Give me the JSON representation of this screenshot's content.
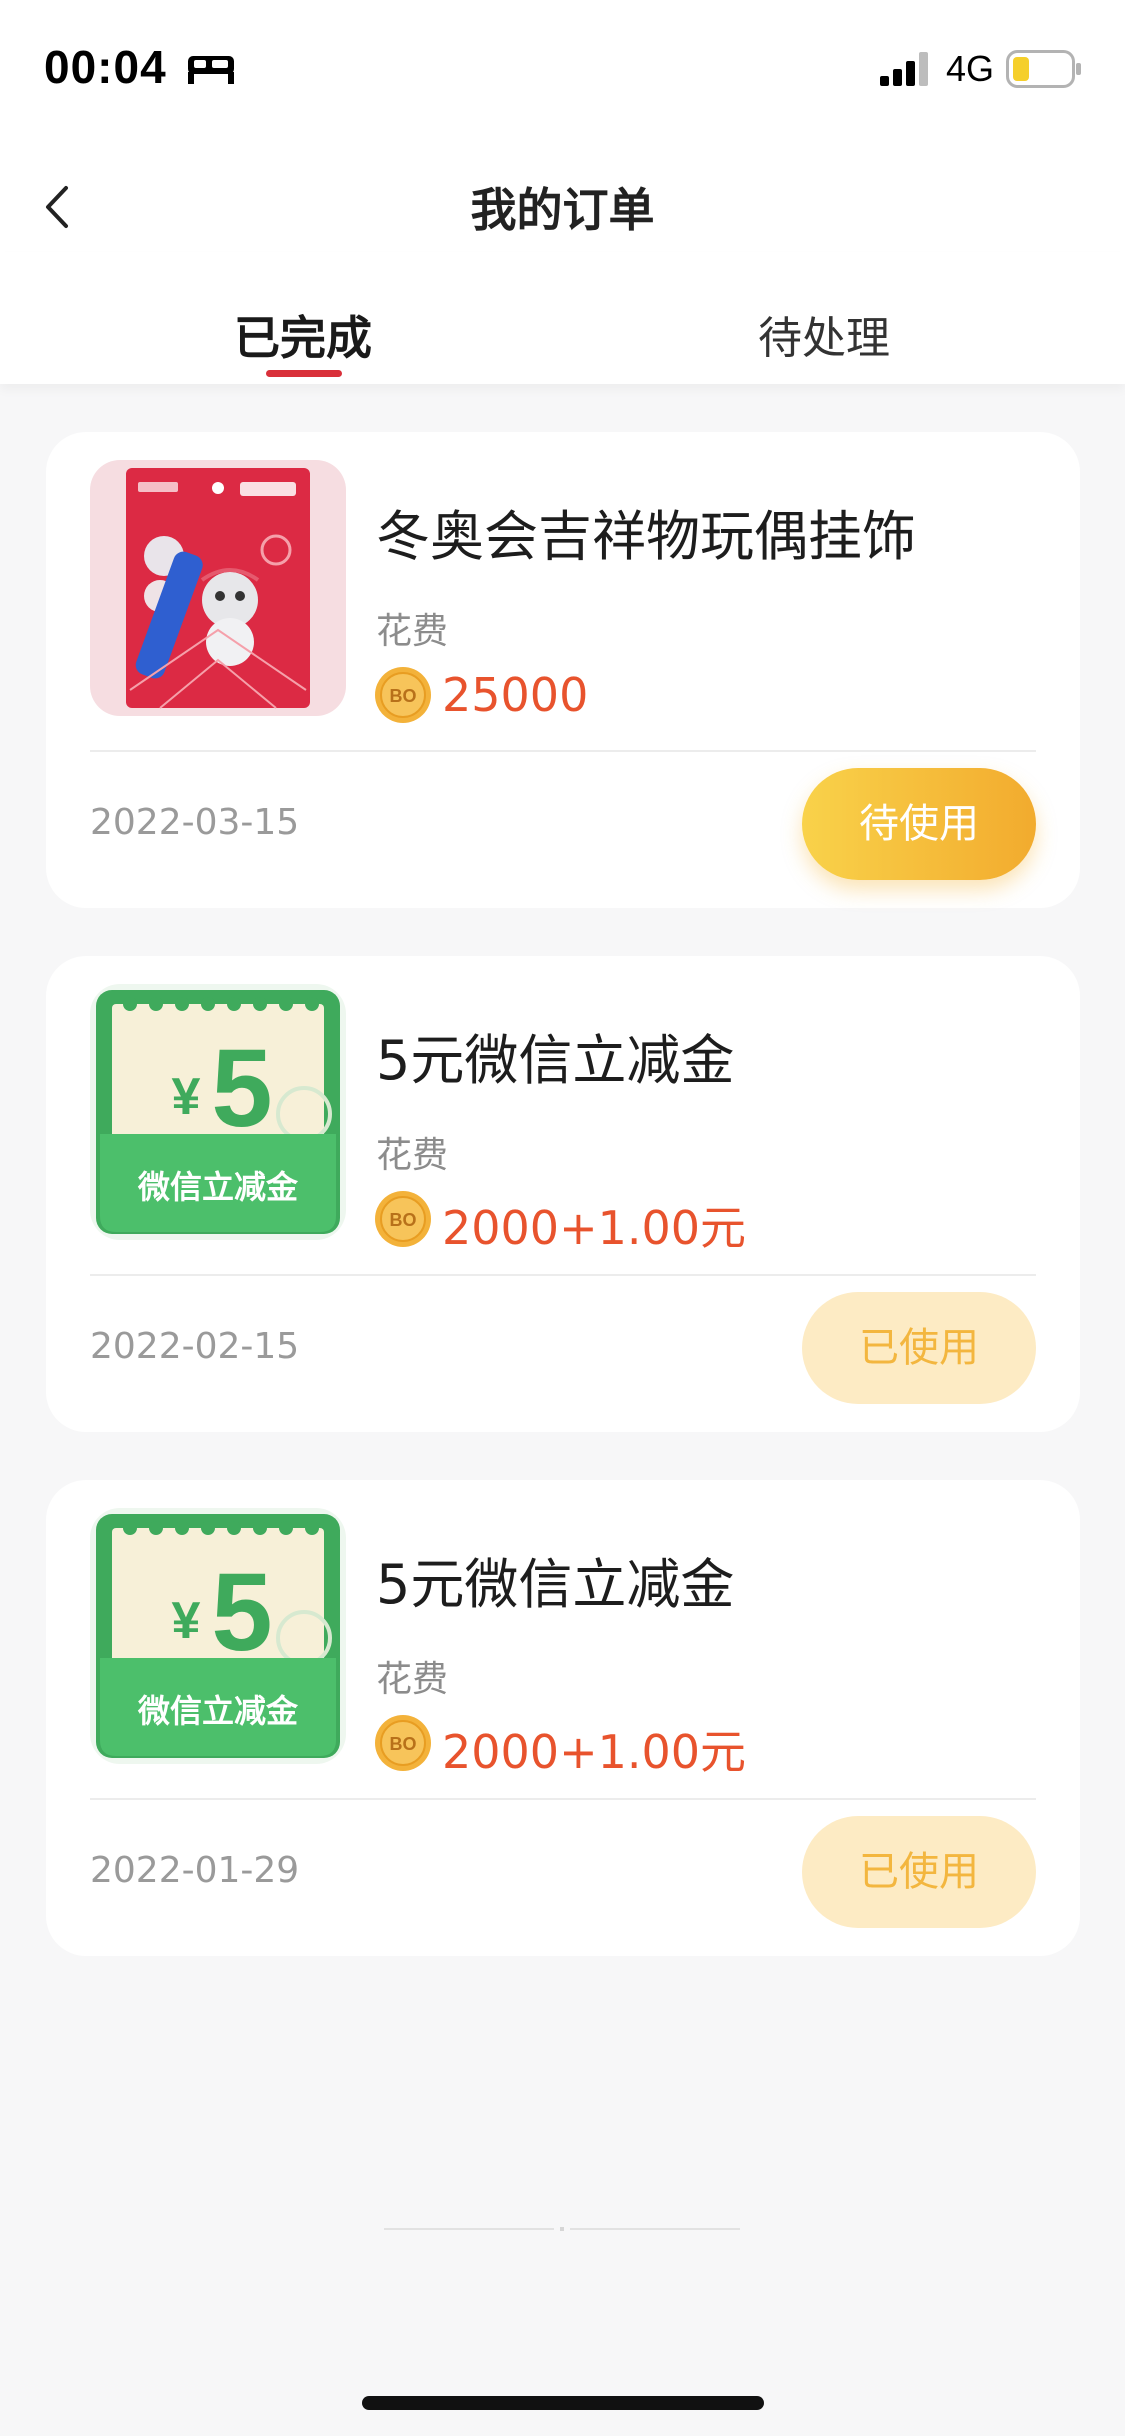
{
  "status_bar": {
    "time": "00:04",
    "network": "4G",
    "icons": [
      "bed-icon",
      "signal-icon",
      "battery-icon"
    ]
  },
  "nav": {
    "title": "我的订单",
    "back_icon": "chevron-left-icon"
  },
  "tabs": [
    {
      "label": "已完成",
      "active": true
    },
    {
      "label": "待处理",
      "active": false
    }
  ],
  "orders": [
    {
      "name": "冬奥会吉祥物玩偶挂饰",
      "cost_label": "花费",
      "price": "25000",
      "date": "2022-03-15",
      "status": "待使用",
      "status_type": "pending",
      "thumbnail": "mascot-keychain-image"
    },
    {
      "name": "5元微信立减金",
      "cost_label": "花费",
      "price": "2000+1.00元",
      "date": "2022-02-15",
      "status": "已使用",
      "status_type": "used",
      "thumbnail": "wechat-coupon-image",
      "thumb_amount": "5",
      "thumb_currency": "¥",
      "thumb_caption": "微信立减金"
    },
    {
      "name": "5元微信立减金",
      "cost_label": "花费",
      "price": "2000+1.00元",
      "date": "2022-01-29",
      "status": "已使用",
      "status_type": "used",
      "thumbnail": "wechat-coupon-image",
      "thumb_amount": "5",
      "thumb_currency": "¥",
      "thumb_caption": "微信立减金"
    }
  ],
  "coin_label": "BO",
  "colors": {
    "accent_red": "#d9303a",
    "price_orange": "#e8532d",
    "pending_gold": "#f2ab2e",
    "used_bg": "#fdebc4",
    "coupon_green": "#4cbf6b"
  }
}
